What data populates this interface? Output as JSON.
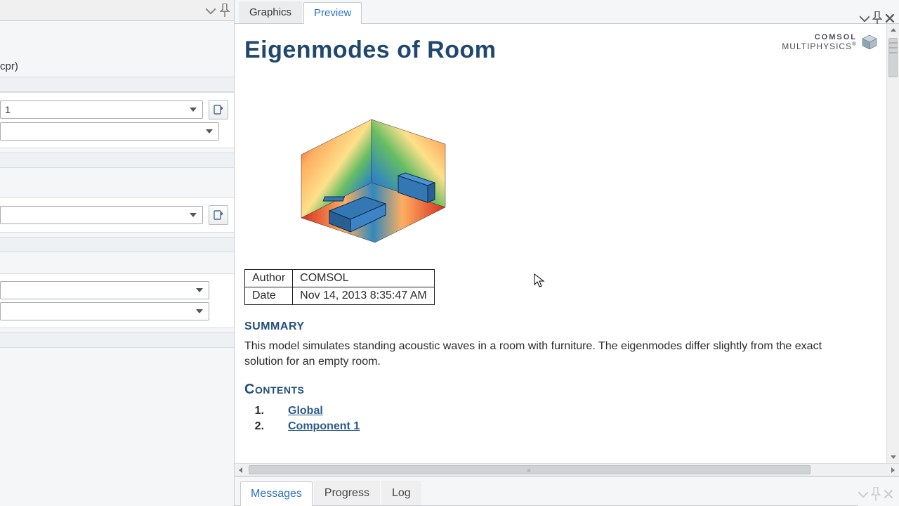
{
  "left": {
    "hint": "cpr)",
    "combo1_value": "1"
  },
  "tabs": {
    "graphics": "Graphics",
    "preview": "Preview"
  },
  "doc": {
    "title": "Eigenmodes of Room",
    "logo_line1": "COMSOL",
    "logo_line2": "MULTIPHYSICS",
    "meta": {
      "author_label": "Author",
      "author_value": "COMSOL",
      "date_label": "Date",
      "date_value": "Nov 14, 2013 8:35:47 AM"
    },
    "summary_head": "SUMMARY",
    "summary_text": "This model simulates standing acoustic waves in a room with furniture. The eigenmodes differ slightly from the exact solution for an empty room.",
    "contents_head": "Contents",
    "toc": [
      {
        "num": "1.",
        "label": "Global"
      },
      {
        "num": "2.",
        "label": "Component 1"
      }
    ]
  },
  "bottom_tabs": {
    "messages": "Messages",
    "progress": "Progress",
    "log": "Log"
  }
}
